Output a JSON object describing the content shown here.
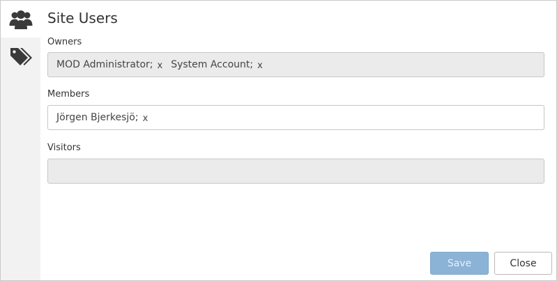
{
  "dialog": {
    "title": "Site Users"
  },
  "sidebar": {
    "tabs": [
      {
        "icon": "users-icon",
        "active": true
      },
      {
        "icon": "tags-icon",
        "active": false
      }
    ]
  },
  "fields": {
    "owners": {
      "label": "Owners",
      "disabled": true,
      "chips": [
        "MOD Administrator;",
        "System Account;"
      ]
    },
    "members": {
      "label": "Members",
      "disabled": false,
      "chips": [
        "Jörgen Bjerkesjö;"
      ]
    },
    "visitors": {
      "label": "Visitors",
      "disabled": true,
      "chips": []
    }
  },
  "chip_remove_glyph": "x",
  "buttons": {
    "save_label": "Save",
    "close_label": "Close"
  },
  "colors": {
    "accent": "#8bb3d6",
    "sidebar_bg": "#f2f2f2",
    "disabled_field_bg": "#ebebeb"
  }
}
